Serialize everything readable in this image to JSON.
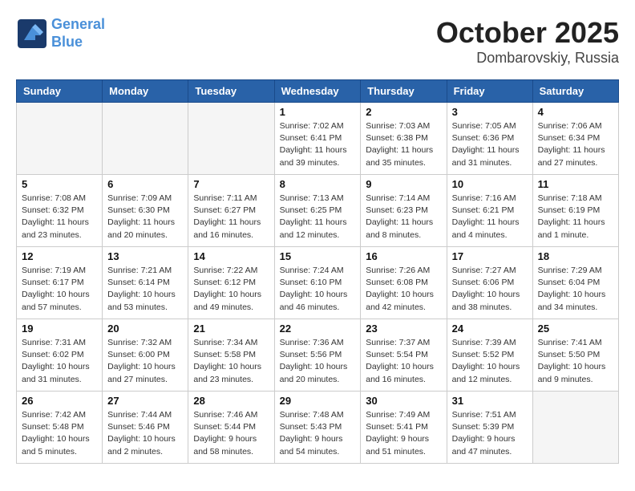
{
  "header": {
    "logo_line1": "General",
    "logo_line2": "Blue",
    "month": "October 2025",
    "location": "Dombarovskiy, Russia"
  },
  "weekdays": [
    "Sunday",
    "Monday",
    "Tuesday",
    "Wednesday",
    "Thursday",
    "Friday",
    "Saturday"
  ],
  "weeks": [
    [
      {
        "day": "",
        "info": ""
      },
      {
        "day": "",
        "info": ""
      },
      {
        "day": "",
        "info": ""
      },
      {
        "day": "1",
        "info": "Sunrise: 7:02 AM\nSunset: 6:41 PM\nDaylight: 11 hours\nand 39 minutes."
      },
      {
        "day": "2",
        "info": "Sunrise: 7:03 AM\nSunset: 6:38 PM\nDaylight: 11 hours\nand 35 minutes."
      },
      {
        "day": "3",
        "info": "Sunrise: 7:05 AM\nSunset: 6:36 PM\nDaylight: 11 hours\nand 31 minutes."
      },
      {
        "day": "4",
        "info": "Sunrise: 7:06 AM\nSunset: 6:34 PM\nDaylight: 11 hours\nand 27 minutes."
      }
    ],
    [
      {
        "day": "5",
        "info": "Sunrise: 7:08 AM\nSunset: 6:32 PM\nDaylight: 11 hours\nand 23 minutes."
      },
      {
        "day": "6",
        "info": "Sunrise: 7:09 AM\nSunset: 6:30 PM\nDaylight: 11 hours\nand 20 minutes."
      },
      {
        "day": "7",
        "info": "Sunrise: 7:11 AM\nSunset: 6:27 PM\nDaylight: 11 hours\nand 16 minutes."
      },
      {
        "day": "8",
        "info": "Sunrise: 7:13 AM\nSunset: 6:25 PM\nDaylight: 11 hours\nand 12 minutes."
      },
      {
        "day": "9",
        "info": "Sunrise: 7:14 AM\nSunset: 6:23 PM\nDaylight: 11 hours\nand 8 minutes."
      },
      {
        "day": "10",
        "info": "Sunrise: 7:16 AM\nSunset: 6:21 PM\nDaylight: 11 hours\nand 4 minutes."
      },
      {
        "day": "11",
        "info": "Sunrise: 7:18 AM\nSunset: 6:19 PM\nDaylight: 11 hours\nand 1 minute."
      }
    ],
    [
      {
        "day": "12",
        "info": "Sunrise: 7:19 AM\nSunset: 6:17 PM\nDaylight: 10 hours\nand 57 minutes."
      },
      {
        "day": "13",
        "info": "Sunrise: 7:21 AM\nSunset: 6:14 PM\nDaylight: 10 hours\nand 53 minutes."
      },
      {
        "day": "14",
        "info": "Sunrise: 7:22 AM\nSunset: 6:12 PM\nDaylight: 10 hours\nand 49 minutes."
      },
      {
        "day": "15",
        "info": "Sunrise: 7:24 AM\nSunset: 6:10 PM\nDaylight: 10 hours\nand 46 minutes."
      },
      {
        "day": "16",
        "info": "Sunrise: 7:26 AM\nSunset: 6:08 PM\nDaylight: 10 hours\nand 42 minutes."
      },
      {
        "day": "17",
        "info": "Sunrise: 7:27 AM\nSunset: 6:06 PM\nDaylight: 10 hours\nand 38 minutes."
      },
      {
        "day": "18",
        "info": "Sunrise: 7:29 AM\nSunset: 6:04 PM\nDaylight: 10 hours\nand 34 minutes."
      }
    ],
    [
      {
        "day": "19",
        "info": "Sunrise: 7:31 AM\nSunset: 6:02 PM\nDaylight: 10 hours\nand 31 minutes."
      },
      {
        "day": "20",
        "info": "Sunrise: 7:32 AM\nSunset: 6:00 PM\nDaylight: 10 hours\nand 27 minutes."
      },
      {
        "day": "21",
        "info": "Sunrise: 7:34 AM\nSunset: 5:58 PM\nDaylight: 10 hours\nand 23 minutes."
      },
      {
        "day": "22",
        "info": "Sunrise: 7:36 AM\nSunset: 5:56 PM\nDaylight: 10 hours\nand 20 minutes."
      },
      {
        "day": "23",
        "info": "Sunrise: 7:37 AM\nSunset: 5:54 PM\nDaylight: 10 hours\nand 16 minutes."
      },
      {
        "day": "24",
        "info": "Sunrise: 7:39 AM\nSunset: 5:52 PM\nDaylight: 10 hours\nand 12 minutes."
      },
      {
        "day": "25",
        "info": "Sunrise: 7:41 AM\nSunset: 5:50 PM\nDaylight: 10 hours\nand 9 minutes."
      }
    ],
    [
      {
        "day": "26",
        "info": "Sunrise: 7:42 AM\nSunset: 5:48 PM\nDaylight: 10 hours\nand 5 minutes."
      },
      {
        "day": "27",
        "info": "Sunrise: 7:44 AM\nSunset: 5:46 PM\nDaylight: 10 hours\nand 2 minutes."
      },
      {
        "day": "28",
        "info": "Sunrise: 7:46 AM\nSunset: 5:44 PM\nDaylight: 9 hours\nand 58 minutes."
      },
      {
        "day": "29",
        "info": "Sunrise: 7:48 AM\nSunset: 5:43 PM\nDaylight: 9 hours\nand 54 minutes."
      },
      {
        "day": "30",
        "info": "Sunrise: 7:49 AM\nSunset: 5:41 PM\nDaylight: 9 hours\nand 51 minutes."
      },
      {
        "day": "31",
        "info": "Sunrise: 7:51 AM\nSunset: 5:39 PM\nDaylight: 9 hours\nand 47 minutes."
      },
      {
        "day": "",
        "info": ""
      }
    ]
  ]
}
